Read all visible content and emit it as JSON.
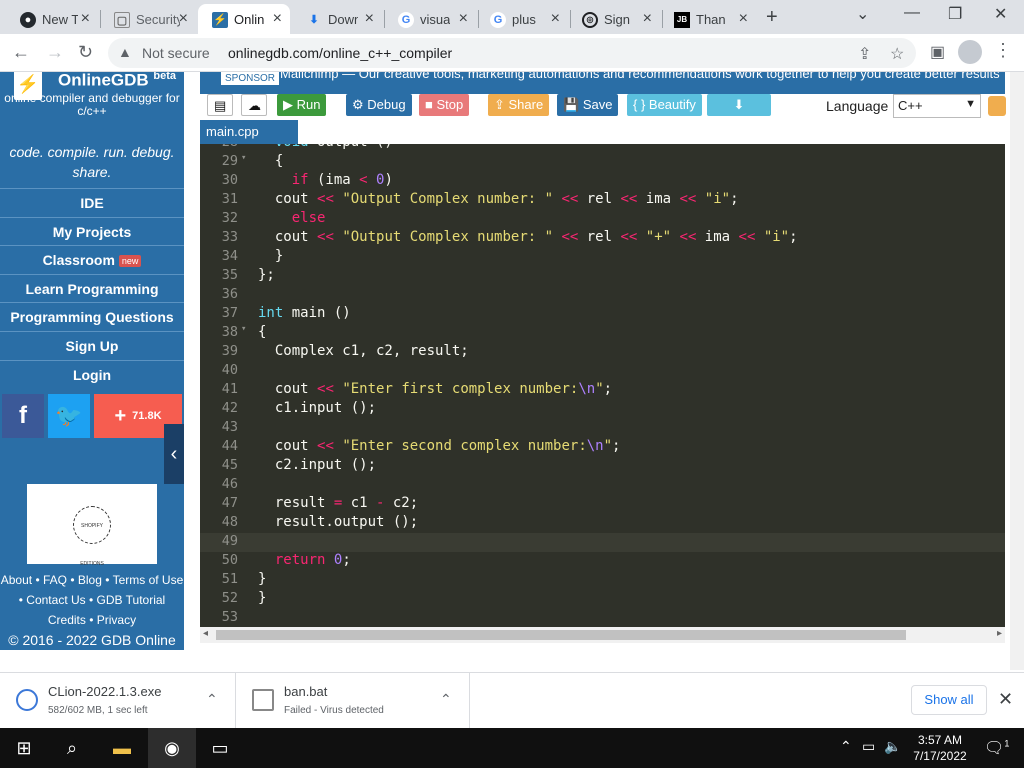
{
  "browser": {
    "tabs": [
      {
        "label": "New Tab",
        "icon": "github-icon"
      },
      {
        "label": "Security e",
        "icon": "page-icon"
      },
      {
        "label": "Online",
        "icon": "onlinegdb-icon",
        "active": true
      },
      {
        "label": "Down",
        "icon": "download-icon"
      },
      {
        "label": "visua",
        "icon": "google-icon"
      },
      {
        "label": "plus",
        "icon": "google-icon"
      },
      {
        "label": "Sign",
        "icon": "app-icon"
      },
      {
        "label": "Thank",
        "icon": "jetbrains-icon"
      }
    ],
    "new_tab": "+",
    "security": "Not secure",
    "url": "onlinegdb.com/online_c++_compiler"
  },
  "sidebar": {
    "brand": "OnlineGDB",
    "beta": "beta",
    "tagline": "online compiler and debugger for c/c++",
    "motto": "code. compile. run. debug. share.",
    "nav": [
      "IDE",
      "My Projects",
      "Classroom",
      "Learn Programming",
      "Programming Questions",
      "Sign Up",
      "Login"
    ],
    "new_badge": "new",
    "share_count": "71.8K",
    "ad_seal": "SHOPIFY EDITIONS",
    "footer_links": [
      "About",
      "FAQ",
      "Blog",
      "Terms of Use",
      "Contact Us",
      "GDB Tutorial",
      "Credits",
      "Privacy"
    ],
    "copyright": "© 2016 - 2022 GDB Online"
  },
  "sponsor": {
    "label": "SPONSOR",
    "text": "Mailchimp — Our creative tools, marketing automations and recommendations work together to help you create better results"
  },
  "toolbar": {
    "run": "Run",
    "debug": "Debug",
    "stop": "Stop",
    "share": "Share",
    "save": "Save",
    "beautify": "{ } Beautify",
    "language_label": "Language",
    "language_value": "C++"
  },
  "editor": {
    "file_tab": "main.cpp",
    "current_line": 49
  },
  "downloads": [
    {
      "name": "CLion-2022.1.3.exe",
      "status": "582/602 MB, 1 sec left"
    },
    {
      "name": "ban.bat",
      "status": "Failed - Virus detected"
    }
  ],
  "show_all": "Show all",
  "taskbar": {
    "time": "3:57 AM",
    "date": "7/17/2022",
    "notification_count": "1"
  },
  "colors": {
    "sidebar": "#2a6ea6",
    "run": "#3c9a3c",
    "editor_bg": "#2f3129",
    "keyword": "#f92672",
    "string": "#e6db74",
    "number": "#ae81ff"
  }
}
